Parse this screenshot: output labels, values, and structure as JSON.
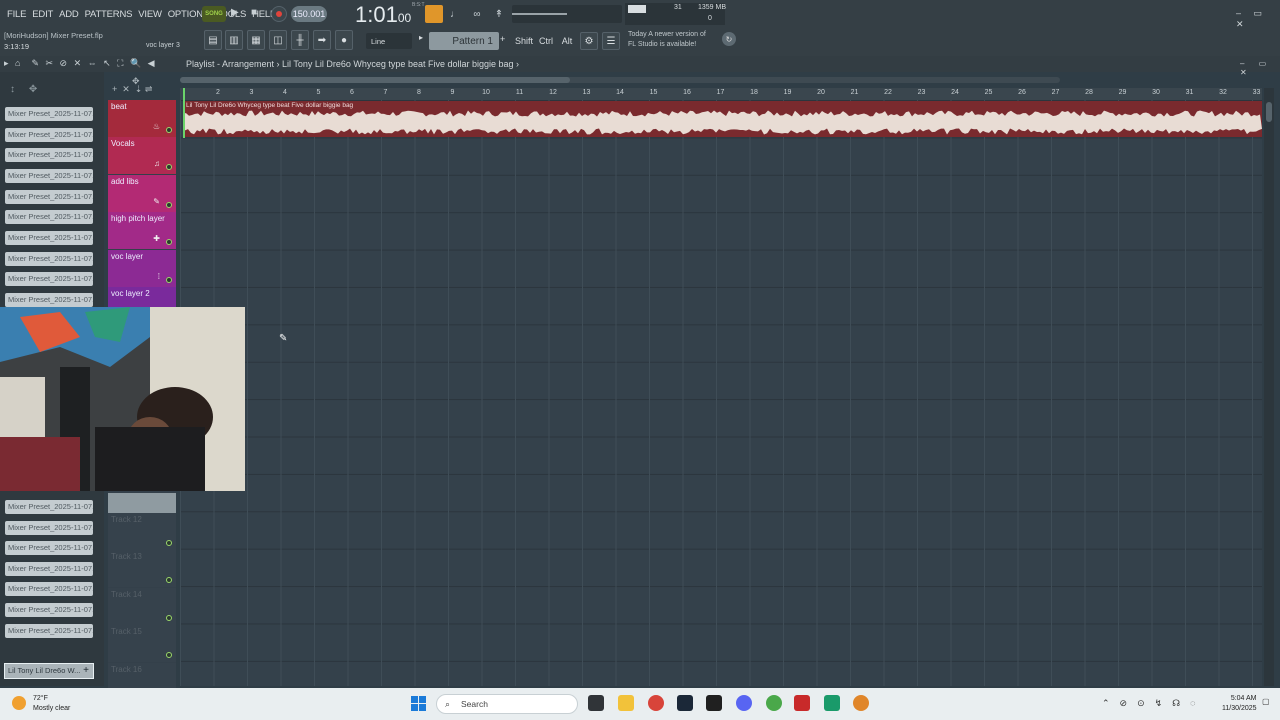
{
  "menu": [
    "FILE",
    "EDIT",
    "ADD",
    "PATTERNS",
    "VIEW",
    "OPTIONS",
    "TOOLS",
    "HELP"
  ],
  "transport": {
    "song_label": "SONG",
    "tempo": "150.001",
    "time": "1:01",
    "time_fraction": "00",
    "time_caption": "B:S:T"
  },
  "performance": {
    "cpu": "31",
    "memory": "1359 MB",
    "polyphony": "0"
  },
  "project": {
    "name": "[MoriHudson] Mixer Preset.flp",
    "position": "3:13:19",
    "hint": "voc layer 3"
  },
  "toolbar2": {
    "snap": "Line",
    "pattern": "Pattern 1",
    "keys": [
      "Shift",
      "Ctrl",
      "Alt"
    ]
  },
  "news": {
    "line1": "Today  A newer version of",
    "line2": "FL Studio is available!"
  },
  "playlist": {
    "title": "Playlist - Arrangement",
    "breadcrumb": "Lil Tony  Lil Dre6o  Whyceg type beat Five dollar biggie bag",
    "clip_label": "Lil Tony  Lil Dre6o  Whyceg type beat Five dollar biggie bag"
  },
  "ruler": [
    "2",
    "3",
    "4",
    "5",
    "6",
    "7",
    "8",
    "9",
    "10",
    "11",
    "12",
    "13",
    "14",
    "15",
    "16",
    "17",
    "18",
    "19",
    "20",
    "21",
    "22",
    "23",
    "24",
    "25",
    "26",
    "27",
    "28",
    "29",
    "30",
    "31",
    "32",
    "33"
  ],
  "presets": [
    "Mixer Preset_2025-11-07...",
    "Mixer Preset_2025-11-07...",
    "Mixer Preset_2025-11-07...",
    "Mixer Preset_2025-11-07...",
    "Mixer Preset_2025-11-07...",
    "Mixer Preset_2025-11-07...",
    "Mixer Preset_2025-11-07...",
    "Mixer Preset_2025-11-07...",
    "Mixer Preset_2025-11-07...",
    "Mixer Preset_2025-11-07...",
    "Mixer Preset_2025-11-07...",
    "Mixer Preset_2025-11-07...",
    "Mixer Preset_2025-11-07...",
    "Mixer Preset_2025-11-07...",
    "Mixer Preset_2025-11-07...",
    "Mixer Preset_2025-11-07...",
    "Mixer Preset_2025-11-07..."
  ],
  "last_preset": "Lil Tony  Lil Dre6o  W...",
  "tracks": [
    {
      "name": "beat",
      "color": "#a42a3c"
    },
    {
      "name": "Vocals",
      "color": "#b12a52"
    },
    {
      "name": "add libs",
      "color": "#b32a74"
    },
    {
      "name": "high pitch layer",
      "color": "#a22a88"
    },
    {
      "name": "voc layer",
      "color": "#8c2a94"
    },
    {
      "name": "voc layer 2",
      "color": "#7a2a9c"
    }
  ],
  "empty_tracks": [
    "Track 12",
    "Track 13",
    "Track 14",
    "Track 15",
    "Track 16"
  ],
  "taskbar": {
    "temp": "72°F",
    "condition": "Mostly clear",
    "search": "Search",
    "time": "5:04 AM",
    "date": "11/30/2025"
  }
}
